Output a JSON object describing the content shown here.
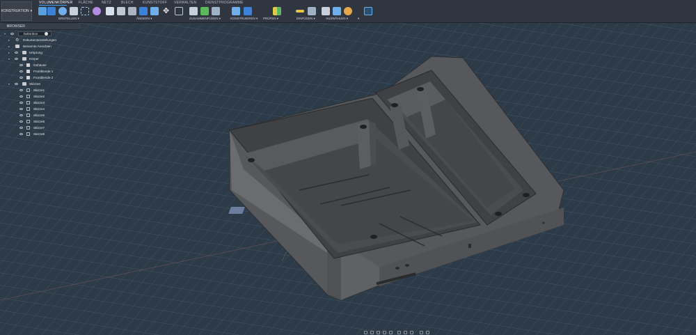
{
  "workspace": {
    "label": "KONSTRUKTION"
  },
  "tabs": [
    "VOLUMENKÖRPER",
    "FLÄCHE",
    "NETZ",
    "BLECH",
    "KUNSTSTOFF",
    "VERWALTEN",
    "DIENSTPROGRAMME"
  ],
  "groups": [
    "ERSTELLEN",
    "ÄNDERN",
    "ZUSAMMENFÜGEN",
    "KONSTRUIEREN",
    "PRÜFEN",
    "EINFÜGEN",
    "AUSWÄHLEN"
  ],
  "browser": {
    "title": "BROWSER",
    "document": "buttonbox",
    "items": [
      {
        "label": "Dokumenteinstellungen",
        "icon": "gear-icon"
      },
      {
        "label": "Benannte Ansichten",
        "icon": "folder-icon"
      },
      {
        "label": "Ursprung",
        "icon": "folder-icon"
      },
      {
        "label": "Körper",
        "icon": "folder-icon"
      },
      {
        "label": "Gehäuse",
        "icon": "body-icon"
      },
      {
        "label": "Frontblende 1",
        "icon": "body-icon"
      },
      {
        "label": "Frontblende 2",
        "icon": "body-icon"
      },
      {
        "label": "Skizzen",
        "icon": "folder-icon"
      },
      {
        "label": "Skizze1",
        "icon": "sketch-icon"
      },
      {
        "label": "Skizze2",
        "icon": "sketch-icon"
      },
      {
        "label": "Skizze3",
        "icon": "sketch-icon"
      },
      {
        "label": "Skizze4",
        "icon": "sketch-icon"
      },
      {
        "label": "Skizze5",
        "icon": "sketch-icon"
      },
      {
        "label": "Skizze6",
        "icon": "sketch-icon"
      },
      {
        "label": "Skizze7",
        "icon": "sketch-icon"
      },
      {
        "label": "Skizze8",
        "icon": "sketch-icon"
      }
    ]
  },
  "colors": {
    "accent": "#4aa3ff",
    "grid_bg": "#2d3b49",
    "model": "#5a5a5c"
  }
}
